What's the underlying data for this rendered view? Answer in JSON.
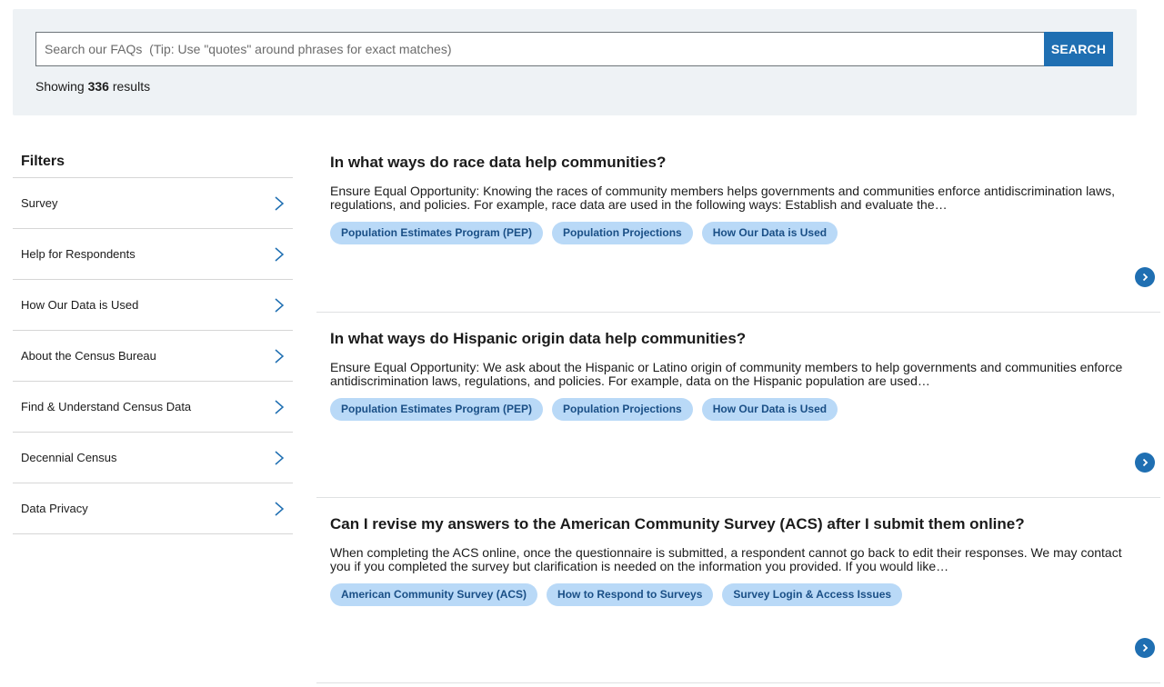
{
  "search": {
    "placeholder": "Search our FAQs  (Tip: Use \"quotes\" around phrases for exact matches)",
    "button_label": "SEARCH",
    "results_prefix": "Showing",
    "results_count": "336",
    "results_suffix": "results"
  },
  "filters": {
    "title": "Filters",
    "items": [
      {
        "label": "Survey"
      },
      {
        "label": "Help for Respondents"
      },
      {
        "label": "How Our Data is Used"
      },
      {
        "label": "About the Census Bureau"
      },
      {
        "label": "Find & Understand Census Data"
      },
      {
        "label": "Decennial Census"
      },
      {
        "label": "Data Privacy"
      }
    ]
  },
  "results": [
    {
      "title": "In what ways do race data help communities?",
      "snippet": "Ensure Equal Opportunity: Knowing the races of community members helps governments and communities enforce antidiscrimination laws, regulations, and policies. For example, race data are used in the following ways: Establish and evaluate the…",
      "tags": [
        "Population Estimates Program (PEP)",
        "Population Projections",
        "How Our Data is Used"
      ]
    },
    {
      "title": "In what ways do Hispanic origin data help communities?",
      "snippet": "Ensure Equal Opportunity: We ask about the Hispanic or Latino origin of community members to help governments and communities enforce antidiscrimination laws, regulations, and policies. For example, data on the Hispanic population are used…",
      "tags": [
        "Population Estimates Program (PEP)",
        "Population Projections",
        "How Our Data is Used"
      ]
    },
    {
      "title": "Can I revise my answers to the American Community Survey (ACS) after I submit them online?",
      "snippet": "When completing the ACS online, once the questionnaire is submitted, a respondent cannot go back to edit their responses. We may contact you if you completed the survey but clarification is needed on the information you provided. If you would like…",
      "tags": [
        "American Community Survey (ACS)",
        "How to Respond to Surveys",
        "Survey Login & Access Issues"
      ]
    }
  ],
  "icons": {
    "filter_chevron": "chevron-right-icon",
    "result_arrow": "arrow-right-circle-icon"
  },
  "colors": {
    "accent": "#1f6fb2",
    "tag_bg": "#b9d9f7",
    "tag_text": "#1a4f86",
    "panel_bg": "#eef2f5"
  }
}
